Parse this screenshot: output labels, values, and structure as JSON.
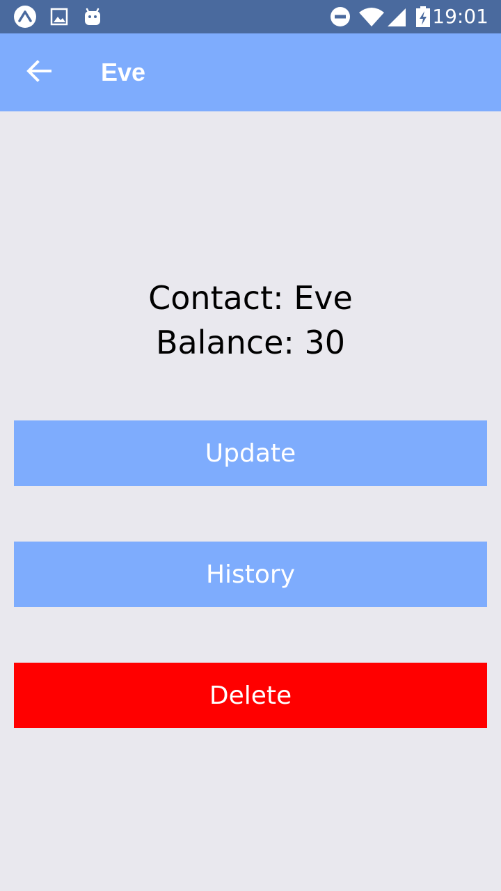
{
  "status_bar": {
    "time": "19:01",
    "left_icons": [
      "expo-icon",
      "image-icon",
      "android-icon"
    ],
    "right_icons": [
      "do-not-disturb-icon",
      "wifi-icon",
      "cell-signal-icon",
      "battery-charging-icon"
    ]
  },
  "app_bar": {
    "title": "Eve",
    "back_icon": "arrow-back-icon"
  },
  "details": {
    "contact_text": "Contact: Eve",
    "balance_text": "Balance: 30"
  },
  "buttons": {
    "update_label": "Update",
    "history_label": "History",
    "delete_label": "Delete"
  },
  "colors": {
    "status_bar": "#4a6a9e",
    "app_bar": "#7eacfd",
    "background": "#e9e8ee",
    "primary_button": "#7eacfd",
    "danger_button": "#ff0000"
  }
}
